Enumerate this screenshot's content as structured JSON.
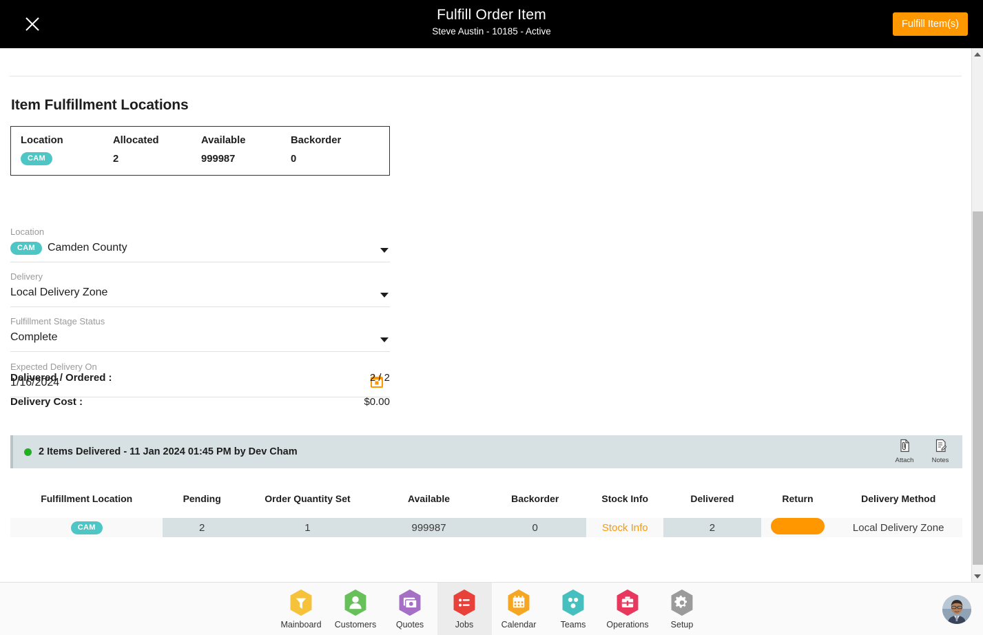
{
  "topbar": {
    "close_icon": "close-icon",
    "title": "Fulfill Order Item",
    "subtitle": "Steve Austin - 10185 - Active",
    "action_label": "Fulfill Item(s)",
    "action_color": "#FF9800",
    "background": "#000000"
  },
  "main": {
    "section_title": "Item Fulfillment Locations",
    "summary": {
      "headers": {
        "location": "Location",
        "allocated": "Allocated",
        "available": "Available",
        "backorder": "Backorder"
      },
      "values": {
        "location_badge": "CAM",
        "allocated": "2",
        "available": "999987",
        "backorder": "0"
      }
    },
    "fields": [
      {
        "label": "Location",
        "badge": "CAM",
        "value": "Camden County",
        "control": "dropdown"
      },
      {
        "label": "Delivery",
        "badge": "",
        "value": "Local Delivery Zone",
        "control": "dropdown"
      },
      {
        "label": "Fulfillment Stage Status",
        "badge": "",
        "value": "Complete",
        "control": "dropdown"
      },
      {
        "label": "Expected Delivery On",
        "badge": "",
        "value": "1/16/2024",
        "control": "datepicker"
      }
    ],
    "totals": [
      {
        "label": "Delivered / Ordered :",
        "value": "2 / 2"
      },
      {
        "label": "Delivery Cost :",
        "value": "$0.00"
      }
    ],
    "status_bar": {
      "dot_color": "#21b021",
      "text": "2 Items Delivered - 11 Jan 2024 01:45 PM by Dev Cham",
      "actions": [
        {
          "icon": "attach-icon",
          "label": "Attach"
        },
        {
          "icon": "notes-icon",
          "label": "Notes"
        }
      ]
    },
    "table": {
      "columns": [
        "Fulfillment Location",
        "Pending",
        "Order Quantity Set",
        "Available",
        "Backorder",
        "Stock Info",
        "Delivered",
        "Return",
        "Delivery Method"
      ],
      "rows": [
        {
          "fulfillment_location": "CAM",
          "pending": "2",
          "order_quantity_set": "1",
          "available": "999987",
          "backorder": "0",
          "stock_info": "Stock Info",
          "delivered": "2",
          "return": "",
          "delivery_method": "Local Delivery Zone"
        }
      ]
    }
  },
  "bottom_nav": {
    "items": [
      {
        "label": "Mainboard",
        "icon": "mainboard-icon",
        "color": "#F5C23A",
        "active": false
      },
      {
        "label": "Customers",
        "icon": "customers-icon",
        "color": "#68C05A",
        "active": false
      },
      {
        "label": "Quotes",
        "icon": "quotes-icon",
        "color": "#A46FC4",
        "active": false
      },
      {
        "label": "Jobs",
        "icon": "jobs-icon",
        "color": "#E8413A",
        "active": true
      },
      {
        "label": "Calendar",
        "icon": "calendar-icon",
        "color": "#F5A623",
        "active": false
      },
      {
        "label": "Teams",
        "icon": "teams-icon",
        "color": "#46BFBF",
        "active": false
      },
      {
        "label": "Operations",
        "icon": "operations-icon",
        "color": "#E8385E",
        "active": false
      },
      {
        "label": "Setup",
        "icon": "setup-icon",
        "color": "#9B9B9B",
        "active": false
      }
    ],
    "avatar": "user-avatar"
  },
  "scrollbar": {
    "up_icon": "scroll-up-icon",
    "down_icon": "scroll-down-icon"
  }
}
